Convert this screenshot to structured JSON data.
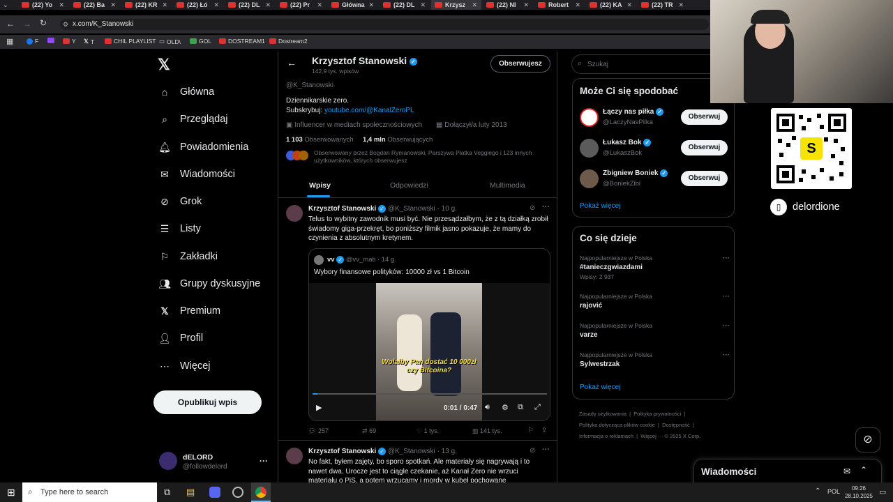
{
  "browser": {
    "tabs": [
      {
        "label": "(22) Yo",
        "active": false
      },
      {
        "label": "(22) Ba",
        "active": false
      },
      {
        "label": "(22) KR",
        "active": false
      },
      {
        "label": "(22) Łó",
        "active": false
      },
      {
        "label": "(22) DL",
        "active": false
      },
      {
        "label": "(22) Pr",
        "active": false
      },
      {
        "label": "Główna",
        "active": false
      },
      {
        "label": "(22) DL",
        "active": false
      },
      {
        "label": "Krzysz",
        "active": true
      },
      {
        "label": "(22) NI",
        "active": false
      },
      {
        "label": "Robert",
        "active": false
      },
      {
        "label": "(22) KA",
        "active": false
      },
      {
        "label": "(22) TR",
        "active": false
      }
    ],
    "url": "x.com/K_Stanowski",
    "bookmarks": [
      "F",
      "Y",
      "T",
      "CHIL PLAYLIST",
      "OLD\\",
      "GOL",
      "DOSTREAM1",
      "Dostream2"
    ]
  },
  "sidebar": {
    "items": [
      "Główna",
      "Przeglądaj",
      "Powiadomienia",
      "Wiadomości",
      "Grok",
      "Listy",
      "Zakładki",
      "Grupy dyskusyjne",
      "Premium",
      "Profil",
      "Więcej"
    ],
    "post_button": "Opublikuj wpis",
    "account_name": "dELORD",
    "account_handle": "@followdelord"
  },
  "profile": {
    "name": "Krzysztof Stanowski",
    "posts_count": "142,9 tys. wpisów",
    "follow_state": "Obserwujesz",
    "handle": "@K_Stanowski",
    "bio_line1": "Dziennikarskie zero.",
    "bio_subscribe_label": "Subskrybuj:",
    "bio_link": "youtube.com/@KanalZeroPL",
    "category": "Influencer w mediach społecznościowych",
    "joined": "Dołączył/a luty 2013",
    "following_count": "1 103",
    "following_label": "Obserwowanych",
    "followers_count": "1,4 mln",
    "followers_label": "Obserwujących",
    "followed_by": "Obserwowany przez Bogdan Rymanowski, Parszywa Płatka Veggiego i 123 innych użytkowników, których obserwujesz",
    "tabs": [
      "Wpisy",
      "Odpowiedzi",
      "Multimedia"
    ]
  },
  "tweet1": {
    "author": "Krzysztof Stanowski",
    "handle": "@K_Stanowski",
    "time": "· 10 g.",
    "text": "Telus to wybitny zawodnik musi być. Nie przesądzałbym, że z tą działką zrobił świadomy giga-przekręt, bo poniższy filmik jasno pokazuje, że mamy do czynienia z absolutnym kretynem.",
    "quote_author": "vv",
    "quote_handle": "@vv_mati",
    "quote_time": "· 14 g.",
    "quote_text": "Wybory finansowe polityków: 10000 zł vs 1 Bitcoin",
    "video_caption": "Wolałby Pan dostać 10 000zł czy Bitcoina?",
    "video_time": "0:01 / 0:47",
    "video_progress": 0.02,
    "replies": "257",
    "reposts": "69",
    "likes": "1 tys.",
    "views": "141 tys."
  },
  "tweet2": {
    "author": "Krzysztof Stanowski",
    "handle": "@K_Stanowski",
    "time": "· 13 g.",
    "text": "No fakt, byłem zajęty, bo sporo spotkań. Ale materiały się nagrywają i to nawet dwa. Urocze jest to ciągle czekanie, aż Kanał Zero nie wrzuci materiału o PiS, a potem wrzucamy i mordy w kubeł pochowane"
  },
  "right": {
    "search_placeholder": "Szukaj",
    "suggest_title": "Może Ci się spodobać",
    "suggestions": [
      {
        "name": "Łączy nas piłka",
        "handle": "@LaczyNasPilka",
        "button": "Obserwuj"
      },
      {
        "name": "Łukasz Bok",
        "handle": "@LukaszBok",
        "button": "Obserwuj"
      },
      {
        "name": "Zbigniew Boniek",
        "handle": "@BoniekZibi",
        "button": "Obserwuj"
      }
    ],
    "show_more": "Pokaż więcej",
    "trends_title": "Co się dzieje",
    "trends": [
      {
        "context": "Najpopularniejsze w Polska",
        "name": "#tanieczgwiazdami",
        "count": "Wpisy: 2 937"
      },
      {
        "context": "Najpopularniejsze w Polska",
        "name": "rajović",
        "count": ""
      },
      {
        "context": "Najpopularniejsze w Polska",
        "name": "varze",
        "count": ""
      },
      {
        "context": "Najpopularniejsze w Polska",
        "name": "Sylwestrzak",
        "count": ""
      }
    ],
    "trends_more": "Pokaż więcej",
    "footer": [
      "Zasady użytkowania",
      "Polityka prywatności",
      "Polityka dotycząca plików cookie",
      "Dostępność",
      "Informacja o reklamach",
      "Więcej ···",
      "© 2025 X Corp."
    ],
    "messages_title": "Wiadomości"
  },
  "overlay": {
    "streamer_name": "delordione",
    "qr_letter": "S"
  },
  "taskbar": {
    "search_placeholder": "Type here to search",
    "lang": "POL",
    "time": "09:26",
    "date": "28.10.2025"
  }
}
